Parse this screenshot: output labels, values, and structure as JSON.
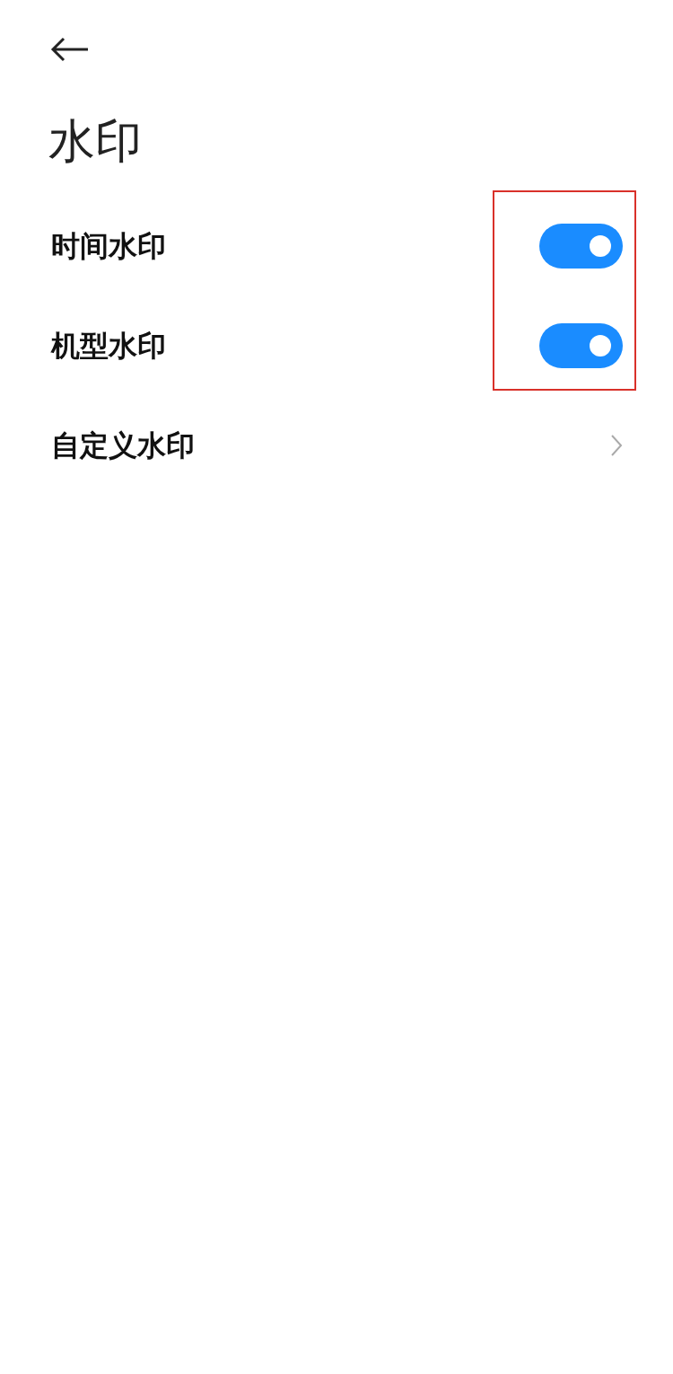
{
  "title": "水印",
  "items": [
    {
      "kind": "toggle",
      "label": "时间水印",
      "on": true
    },
    {
      "kind": "toggle",
      "label": "机型水印",
      "on": true
    },
    {
      "kind": "link",
      "label": "自定义水印"
    }
  ]
}
